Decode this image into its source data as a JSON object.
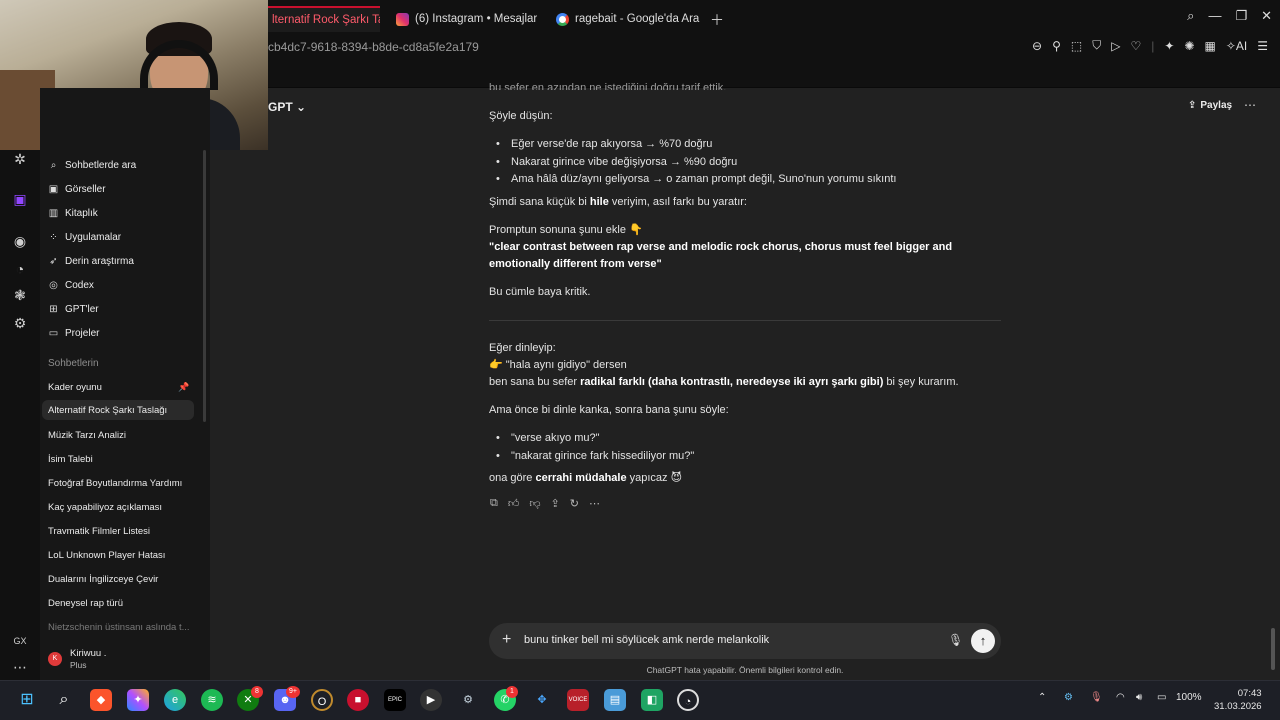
{
  "browser": {
    "tabs": [
      {
        "label": "lternatif Rock Şarkı Tasla"
      },
      {
        "label": "(6) Instagram • Mesajlar"
      },
      {
        "label": "ragebait - Google'da Ara"
      }
    ],
    "url": "cb4dc7-9618-8394-b8de-cd8a5fe2a179",
    "ai_label": "AI"
  },
  "app": {
    "title_fragment": "GPT",
    "share_label": "Paylaş"
  },
  "sidebar": {
    "nav": [
      {
        "label": "Sohbetlerde ara",
        "icon": "search-icon"
      },
      {
        "label": "Görseller",
        "icon": "image-icon"
      },
      {
        "label": "Kitaplık",
        "icon": "library-icon"
      },
      {
        "label": "Uygulamalar",
        "icon": "apps-icon"
      },
      {
        "label": "Derin araştırma",
        "icon": "telescope-icon"
      },
      {
        "label": "Codex",
        "icon": "codex-icon"
      },
      {
        "label": "GPT'ler",
        "icon": "grid-icon"
      },
      {
        "label": "Projeler",
        "icon": "folder-icon"
      }
    ],
    "section_label": "Sohbetlerin",
    "chats": [
      {
        "label": "Kader oyunu"
      },
      {
        "label": "Alternatif Rock Şarkı Taslağı"
      },
      {
        "label": "Müzik Tarzı Analizi"
      },
      {
        "label": "İsim Talebi"
      },
      {
        "label": "Fotoğraf Boyutlandırma Yardımı"
      },
      {
        "label": "Kaç yapabiliyoz açıklaması"
      },
      {
        "label": "Travmatik Filmler Listesi"
      },
      {
        "label": "LoL Unknown Player Hatası"
      },
      {
        "label": "Dualarını İngilizceye Çevir"
      },
      {
        "label": "Deneysel rap türü"
      },
      {
        "label": "Nietzschenin üstinsanı aslında t..."
      }
    ],
    "user": {
      "initial": "K",
      "name": "Kiriwuu .",
      "plan": "Plus"
    },
    "rail_label": "GX"
  },
  "conversation": {
    "top_cut": "bu sefer en azından ne istediğini doğru tarif ettik.",
    "think_label": "Şöyle düşün:",
    "bullets1": [
      "Eğer verse'de rap akıyorsa → %70 doğru",
      "Nakarat girince vibe değişiyorsa → %90 doğru",
      "Ama hâlâ düz/aynı geliyorsa → o zaman prompt değil, Suno'nun yorumu sıkıntı"
    ],
    "trick_pre": "Şimdi sana küçük bi ",
    "trick_bold": "hile",
    "trick_post": " veriyim, asıl farkı bu yaratır:",
    "prompt_intro": "Promptun sonuna şunu ekle 👇",
    "prompt_text": "\"clear contrast between rap verse and melodic rock chorus, chorus must feel bigger and emotionally different from verse\"",
    "critical": "Bu cümle baya kritik.",
    "listen_label": "Eğer dinleyip:",
    "same_line": "👉 \"hala aynı gidiyo\" dersen",
    "build_pre": "ben sana bu sefer ",
    "build_bold": "radikal farklı (daha kontrastlı, neredeyse iki ayrı şarkı gibi)",
    "build_post": " bi şey kurarım.",
    "ask_line": "Ama önce bi dinle kanka, sonra bana şunu söyle:",
    "bullets2": [
      "\"verse akıyo mu?\"",
      "\"nakarat girince fark hissediliyor mu?\""
    ],
    "end_pre": "ona göre ",
    "end_bold": "cerrahi müdahale",
    "end_post": " yapıcaz 😈"
  },
  "composer": {
    "value": "bunu tinker bell mi söylücek amk nerde melankolik",
    "disclaimer": "ChatGPT hata yapabilir. Önemli bilgileri kontrol edin."
  },
  "taskbar": {
    "badges": {
      "first": "8",
      "discord": "9+",
      "whatsapp": "1"
    },
    "battery": "100%",
    "time": "07:43",
    "date": "31.03.2026",
    "voicemeeter": "VOICE"
  }
}
